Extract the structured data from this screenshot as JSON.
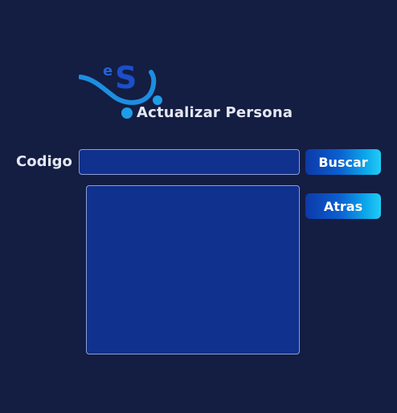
{
  "header": {
    "title": "Actualizar Persona",
    "logo_icon": "es-logo-icon"
  },
  "form": {
    "code_label": "Codigo",
    "code_value": "",
    "result_text": ""
  },
  "buttons": {
    "search_label": "Buscar",
    "back_label": "Atras"
  },
  "colors": {
    "background": "#141d42",
    "field": "#10318d",
    "accent": "#0ca8ea"
  }
}
